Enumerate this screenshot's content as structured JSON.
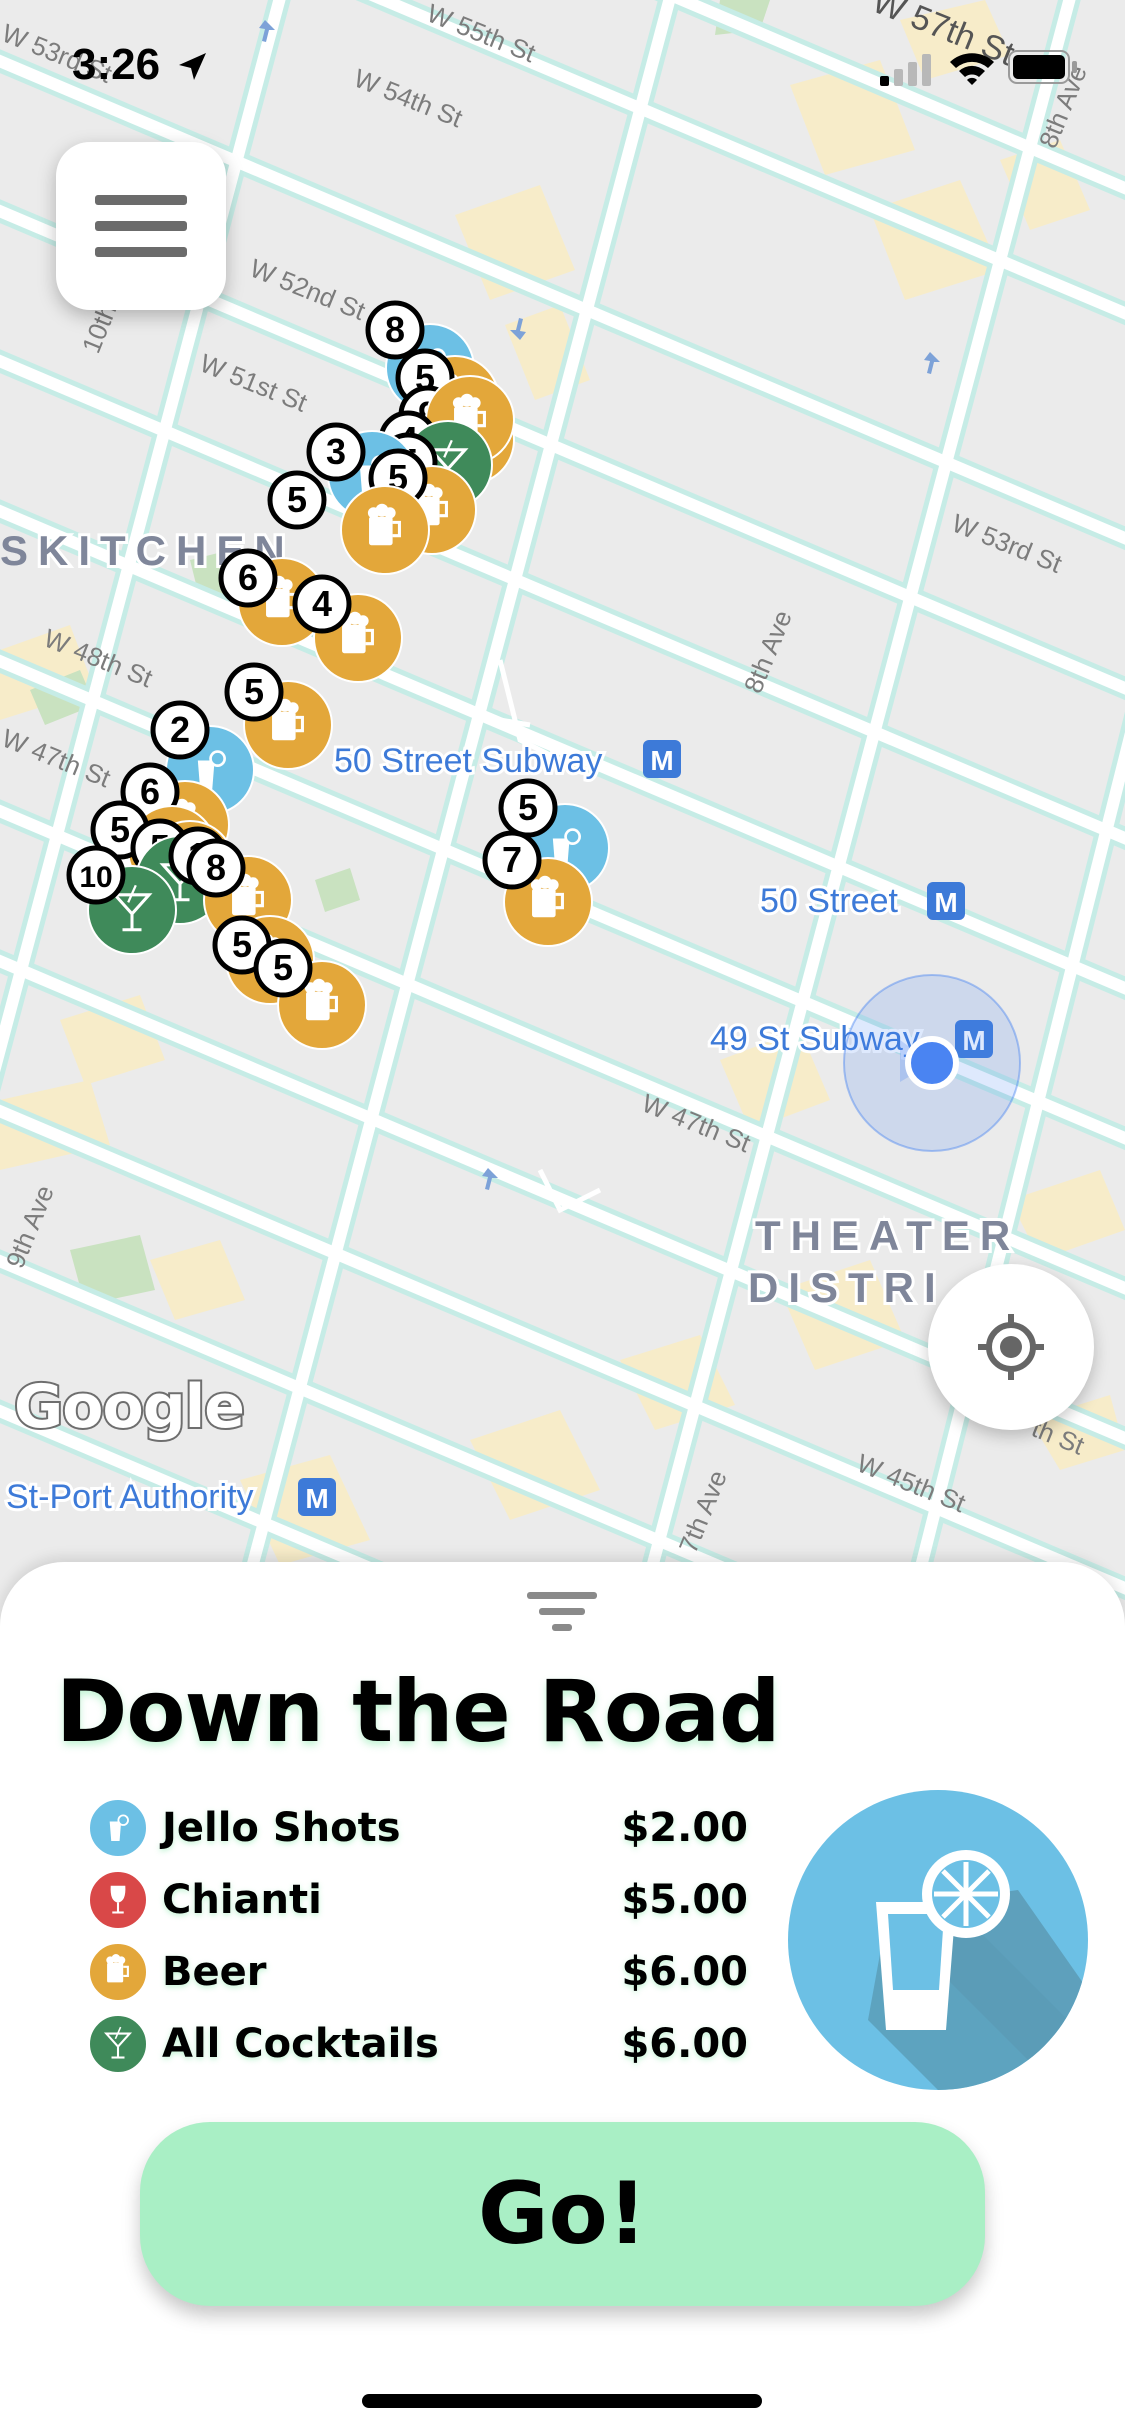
{
  "status_bar": {
    "time": "3:26",
    "icons": [
      "location-arrow-icon",
      "cellular-signal-icon",
      "wifi-icon",
      "battery-icon"
    ]
  },
  "map": {
    "street_labels": [
      "W 53rd St",
      "W 55th St",
      "W 54th St",
      "W 57th St",
      "8th Ave",
      "W 52nd St",
      "W 51st St",
      "10th Ave",
      "W 53rd St",
      "8th Ave",
      "W 48th St",
      "W 47th St",
      "W 47th St",
      "9th Ave",
      "W 45th St",
      "7th Ave",
      "th St"
    ],
    "area_labels": [
      "KITCHEN",
      "THEATER",
      "DISTRI"
    ],
    "transit_labels": [
      "50 Street Subway",
      "50 Street",
      "49 St Subway",
      "St-Port Authority"
    ],
    "transit_badge": "M",
    "attribution": "Google",
    "pins": [
      {
        "category": "jello",
        "count": "8"
      },
      {
        "category": "beer",
        "count": "5"
      },
      {
        "category": "beer",
        "count": "9"
      },
      {
        "category": "beer",
        "count": "4"
      },
      {
        "category": "cocktail",
        "count": "5"
      },
      {
        "category": "jello",
        "count": "3"
      },
      {
        "category": "beer",
        "count": "5"
      },
      {
        "category": "beer",
        "count": "5"
      },
      {
        "category": "beer",
        "count": "6"
      },
      {
        "category": "beer",
        "count": "4"
      },
      {
        "category": "beer",
        "count": "5"
      },
      {
        "category": "jello",
        "count": "2"
      },
      {
        "category": "beer",
        "count": "6"
      },
      {
        "category": "beer",
        "count": "5"
      },
      {
        "category": "beer",
        "count": "5"
      },
      {
        "category": "cocktail",
        "count": "1"
      },
      {
        "category": "beer",
        "count": "8"
      },
      {
        "category": "cocktail",
        "count": "10"
      },
      {
        "category": "beer",
        "count": "5"
      },
      {
        "category": "beer",
        "count": "5"
      },
      {
        "category": "jello",
        "count": "5"
      },
      {
        "category": "beer",
        "count": "7"
      }
    ],
    "colors": {
      "beer": "#e3a73a",
      "jello": "#6cc0e5",
      "cocktail": "#3f8a5a",
      "wine": "#d94848",
      "street": "#ffffff",
      "road_outline": "#c9eee8",
      "block": "#f7ecc9",
      "park": "#c9e2c0",
      "user": "#4a84f2"
    }
  },
  "sheet": {
    "title": "Down the Road",
    "filter_icon": "filter-icon",
    "items": [
      {
        "name": "Jello Shots",
        "price": "$2.00",
        "icon": "jello-shot-icon",
        "color": "#6cc0e5"
      },
      {
        "name": "Chianti",
        "price": "$5.00",
        "icon": "wine-glass-icon",
        "color": "#d94848"
      },
      {
        "name": "Beer",
        "price": "$6.00",
        "icon": "beer-mug-icon",
        "color": "#e3a73a"
      },
      {
        "name": "All Cocktails",
        "price": "$6.00",
        "icon": "cocktail-icon",
        "color": "#3f8a5a"
      }
    ],
    "featured_icon": "jello-shot-icon",
    "go_label": "Go!"
  }
}
